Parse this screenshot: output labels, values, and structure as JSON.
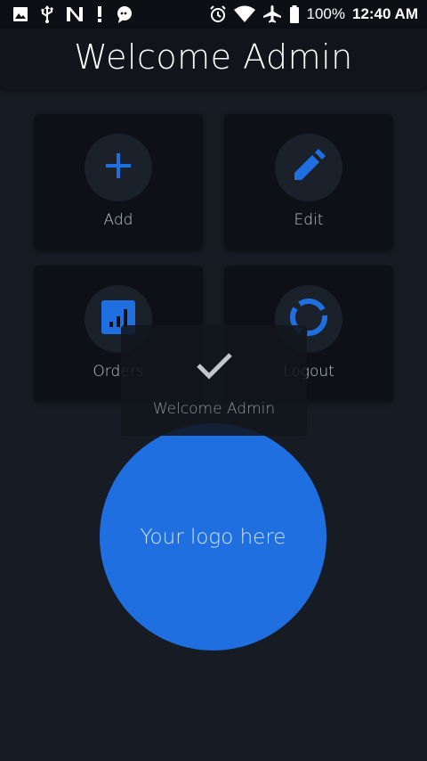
{
  "status_bar": {
    "left_icons": [
      "image-icon",
      "usb-icon",
      "n-icon",
      "exclamation-icon",
      "chat-icon"
    ],
    "right_icons": [
      "alarm-icon",
      "wifi-icon",
      "airplane-icon",
      "battery-icon"
    ],
    "battery": "100%",
    "time": "12:40 AM"
  },
  "app_bar": {
    "title": "Welcome Admin"
  },
  "menu": {
    "items": [
      {
        "label": "Add",
        "icon": "plus-icon"
      },
      {
        "label": "Edit",
        "icon": "pencil-icon"
      },
      {
        "label": "Orders",
        "icon": "bar-chart-icon"
      },
      {
        "label": "Logout",
        "icon": "ring-icon"
      }
    ]
  },
  "toast": {
    "icon": "checkmark-icon",
    "message": "Welcome Admin"
  },
  "logo": {
    "text": "Your logo here"
  },
  "colors": {
    "accent": "#1f6fe0",
    "background": "#171c24",
    "card": "#0d1117",
    "app_bar": "#11151b"
  }
}
